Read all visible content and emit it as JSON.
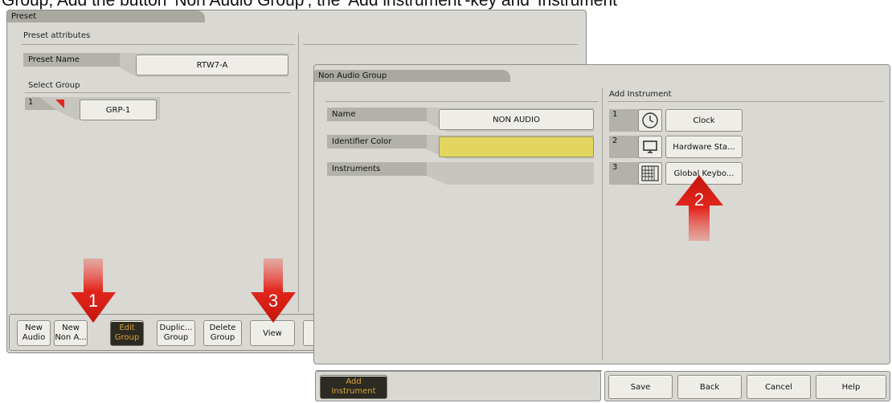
{
  "caption": "Group; Add the button 'Non Audio Group', the 'Add instrument'-key and 'Instrument'",
  "preset_window": {
    "title": "Preset",
    "section_label": "Preset attributes",
    "preset_name_label": "Preset Name",
    "preset_name_value": "RTW7-A",
    "select_group_label": "Select Group",
    "group_index": "1",
    "group_value": "GRP-1",
    "toolbar": [
      {
        "line1": "New",
        "line2": "Audio"
      },
      {
        "line1": "New",
        "line2": "Non A..."
      },
      {
        "line1": "Edit",
        "line2": "Group"
      },
      {
        "line1": "Duplic...",
        "line2": "Group"
      },
      {
        "line1": "Delete",
        "line2": "Group"
      },
      {
        "line1": "View",
        "line2": ""
      }
    ]
  },
  "non_audio_window": {
    "title": "Non Audio Group",
    "name_label": "Name",
    "name_value": "NON AUDIO",
    "identifier_color_label": "Identifier Color",
    "identifier_color": "#e3d660",
    "instruments_label": "Instruments",
    "add_instrument_header": "Add Instrument",
    "instruments": [
      {
        "index": "1",
        "icon": "clock-icon",
        "label": "Clock"
      },
      {
        "index": "2",
        "icon": "monitor-icon",
        "label": "Hardware Sta..."
      },
      {
        "index": "3",
        "icon": "keyboard-icon",
        "label": "Global Keybo..."
      }
    ],
    "add_instrument_button": {
      "line1": "Add",
      "line2": "Instrument"
    },
    "footer_buttons": [
      "Save",
      "Back",
      "Cancel",
      "Help"
    ]
  },
  "annotations": {
    "arrow_1": "1",
    "arrow_2": "2",
    "arrow_3": "3",
    "arrow_color": "#e2261c"
  }
}
